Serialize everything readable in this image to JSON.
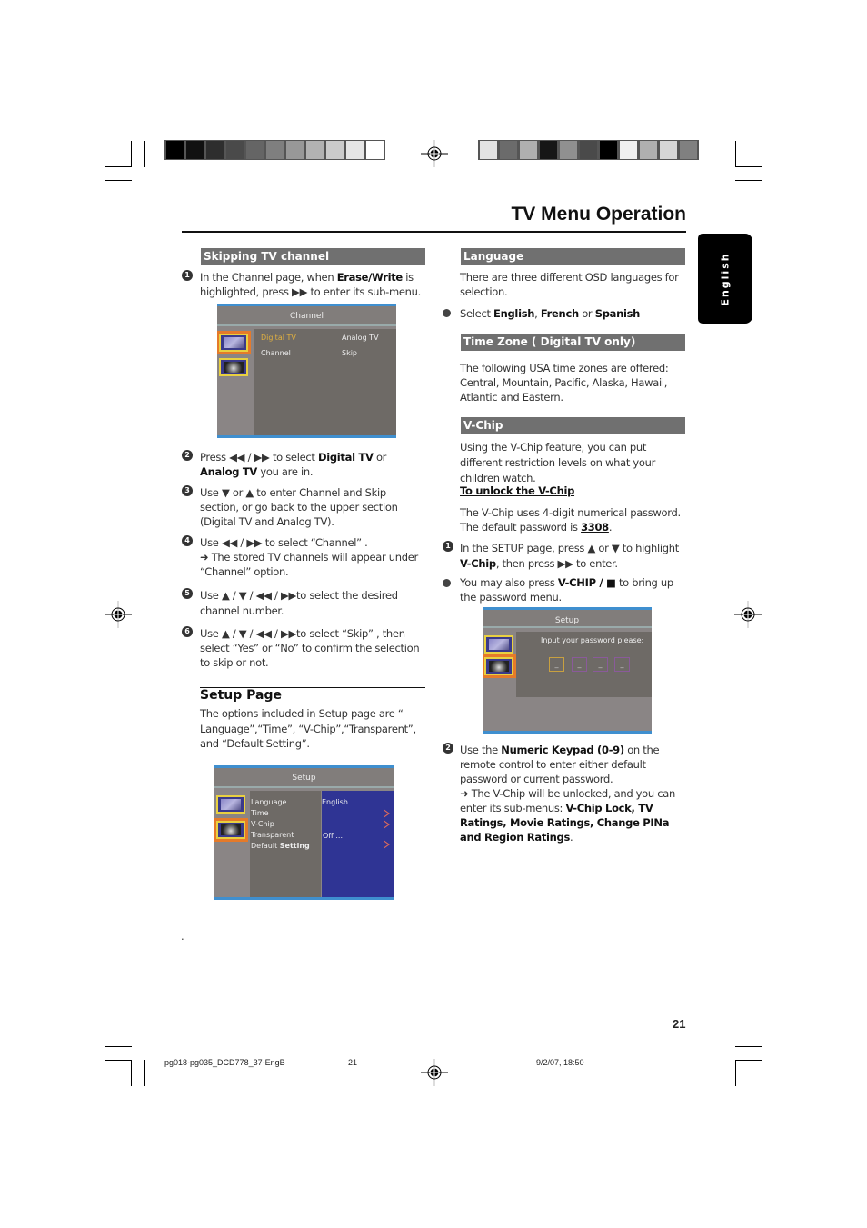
{
  "page": {
    "title": "TV Menu Operation",
    "language_tab": "English",
    "page_number": "21",
    "footer": {
      "filename": "pg018-pg035_DCD778_37-EngB",
      "page": "21",
      "datetime": "9/2/07, 18:50"
    },
    "stray_mark": "."
  },
  "color_bars": {
    "left": [
      "#000000",
      "#111111",
      "#2e2e2e",
      "#4a4a4a",
      "#656565",
      "#7f7f7f",
      "#989898",
      "#b2b2b2",
      "#cbcbcb",
      "#e5e5e5",
      "#ffffff"
    ],
    "right": [
      "#e3e3e3",
      "#6b6b6b",
      "#b0b0b0",
      "#161616",
      "#909090",
      "#4a4a4a",
      "#000000",
      "#f0f0f0",
      "#b0b0b0",
      "#d6d6d6",
      "#808080"
    ]
  },
  "skipping": {
    "heading": "Skipping TV channel",
    "steps": [
      {
        "num": "1",
        "html_parts": [
          "In the Channel page, when ",
          "Erase/Write",
          " is highlighted, press ▶▶ to enter its sub-menu."
        ]
      },
      {
        "num": "2",
        "html_parts": [
          "Press ◀◀ / ▶▶ to select ",
          "Digital TV",
          " or ",
          "Analog TV",
          " you are in."
        ]
      },
      {
        "num": "3",
        "text": "Use ▼ or ▲  to enter Channel and Skip section, or go back to the upper section (Digital TV and Analog TV)."
      },
      {
        "num": "4",
        "text": "Use ◀◀  / ▶▶  to select  “Channel” .",
        "note": "➜  The stored TV channels will appear under “Channel” option."
      },
      {
        "num": "5",
        "text": "Use  ▲  /  ▼  /  ◀◀ /   ▶▶to select the desired channel number."
      },
      {
        "num": "6",
        "text": "Use ▲  /  ▼  /  ◀◀ /   ▶▶to select “Skip” , then select “Yes” or “No” to confirm the selection to skip or not."
      }
    ],
    "osd": {
      "header": "Channel",
      "row1_left": "Digital TV",
      "row1_right": "Analog TV",
      "row2_left": "Channel",
      "row2_right": "Skip"
    }
  },
  "setup": {
    "heading": "Setup Page",
    "body": "The options included in Setup page are “ Language”,“Time”,  “V-Chip”,“Transparent”, and “Default Setting”.",
    "osd": {
      "header": "Setup",
      "items": [
        "Language",
        "Time",
        "V-Chip",
        "Transparent",
        "Default"
      ],
      "default_suffix": "Setting",
      "values": {
        "language": "English  ...",
        "transparent": "Off  ..."
      }
    }
  },
  "language": {
    "heading": "Language",
    "body": "There are three different OSD languages for selection.",
    "bullet_parts": [
      "Select ",
      "English",
      ", ",
      "French",
      " or ",
      "Spanish"
    ]
  },
  "timezone": {
    "heading": "Time Zone ( Digital TV only)",
    "body": "The following USA time zones are offered: Central, Mountain, Pacific, Alaska, Hawaii, Atlantic and Eastern."
  },
  "vchip": {
    "heading": "V-Chip",
    "body": "Using the V-Chip feature, you can put different restriction levels on what your children watch.",
    "unlock_heading": "To unlock the V-Chip",
    "unlock_body_parts": [
      "The V-Chip uses 4-digit numerical password. The default password is ",
      "3308",
      "."
    ],
    "step1_parts": [
      "In the SETUP page, press ▲ or ▼ to highlight ",
      "V-Chip",
      ", then press ▶▶  to enter."
    ],
    "bullet_parts": [
      "You may also press ",
      "V-CHIP / ■",
      "  to bring up the password menu."
    ],
    "step2_parts": [
      "Use the  ",
      "Numeric Keypad (0-9)",
      " on the remote control to enter either default password or current password."
    ],
    "step2_note_parts": [
      "➜ The V-Chip will be unlocked, and you can enter its sub-menus: ",
      "V-Chip Lock, TV Ratings, Movie Ratings, Change PINa and Region Ratings",
      "."
    ],
    "osd": {
      "header": "Setup",
      "prompt": "Input your password please:",
      "boxes": [
        "_",
        "_",
        "_",
        "_"
      ]
    }
  }
}
